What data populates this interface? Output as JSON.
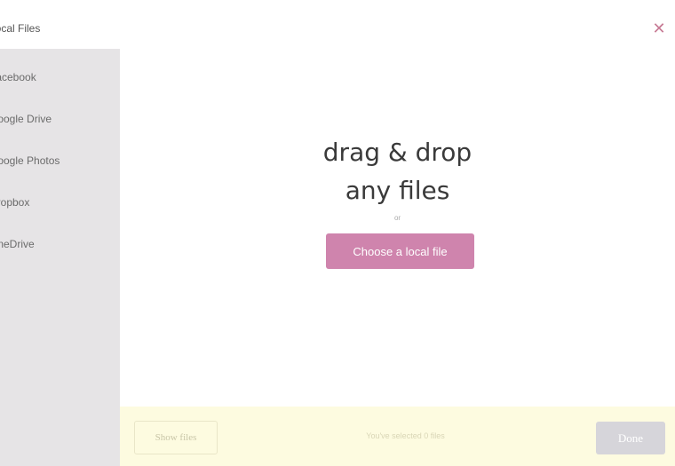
{
  "sidebar": {
    "items": [
      {
        "label": "Local Files",
        "icon": "folder-icon"
      },
      {
        "label": "Facebook",
        "icon": "facebook-icon"
      },
      {
        "label": "Google Drive",
        "icon": "google-drive-icon"
      },
      {
        "label": "Google Photos",
        "icon": "google-photos-icon"
      },
      {
        "label": "Dropbox",
        "icon": "dropbox-icon"
      },
      {
        "label": "OneDrive",
        "icon": "onedrive-icon"
      }
    ]
  },
  "header": {
    "close_symbol": "✕"
  },
  "dropzone": {
    "line1": "drag & drop",
    "line2": "any files",
    "or_text": "or",
    "choose_label": "Choose a local file"
  },
  "footer": {
    "show_files_label": "Show files",
    "selected_text": "You've selected 0 files",
    "done_label": "Done"
  },
  "colors": {
    "accent": "#cf84ad",
    "close": "#c77b95",
    "sidebar_bg": "#e6e4e6",
    "footer_bg": "#fdfbe0",
    "done_disabled": "#d6d5da"
  }
}
